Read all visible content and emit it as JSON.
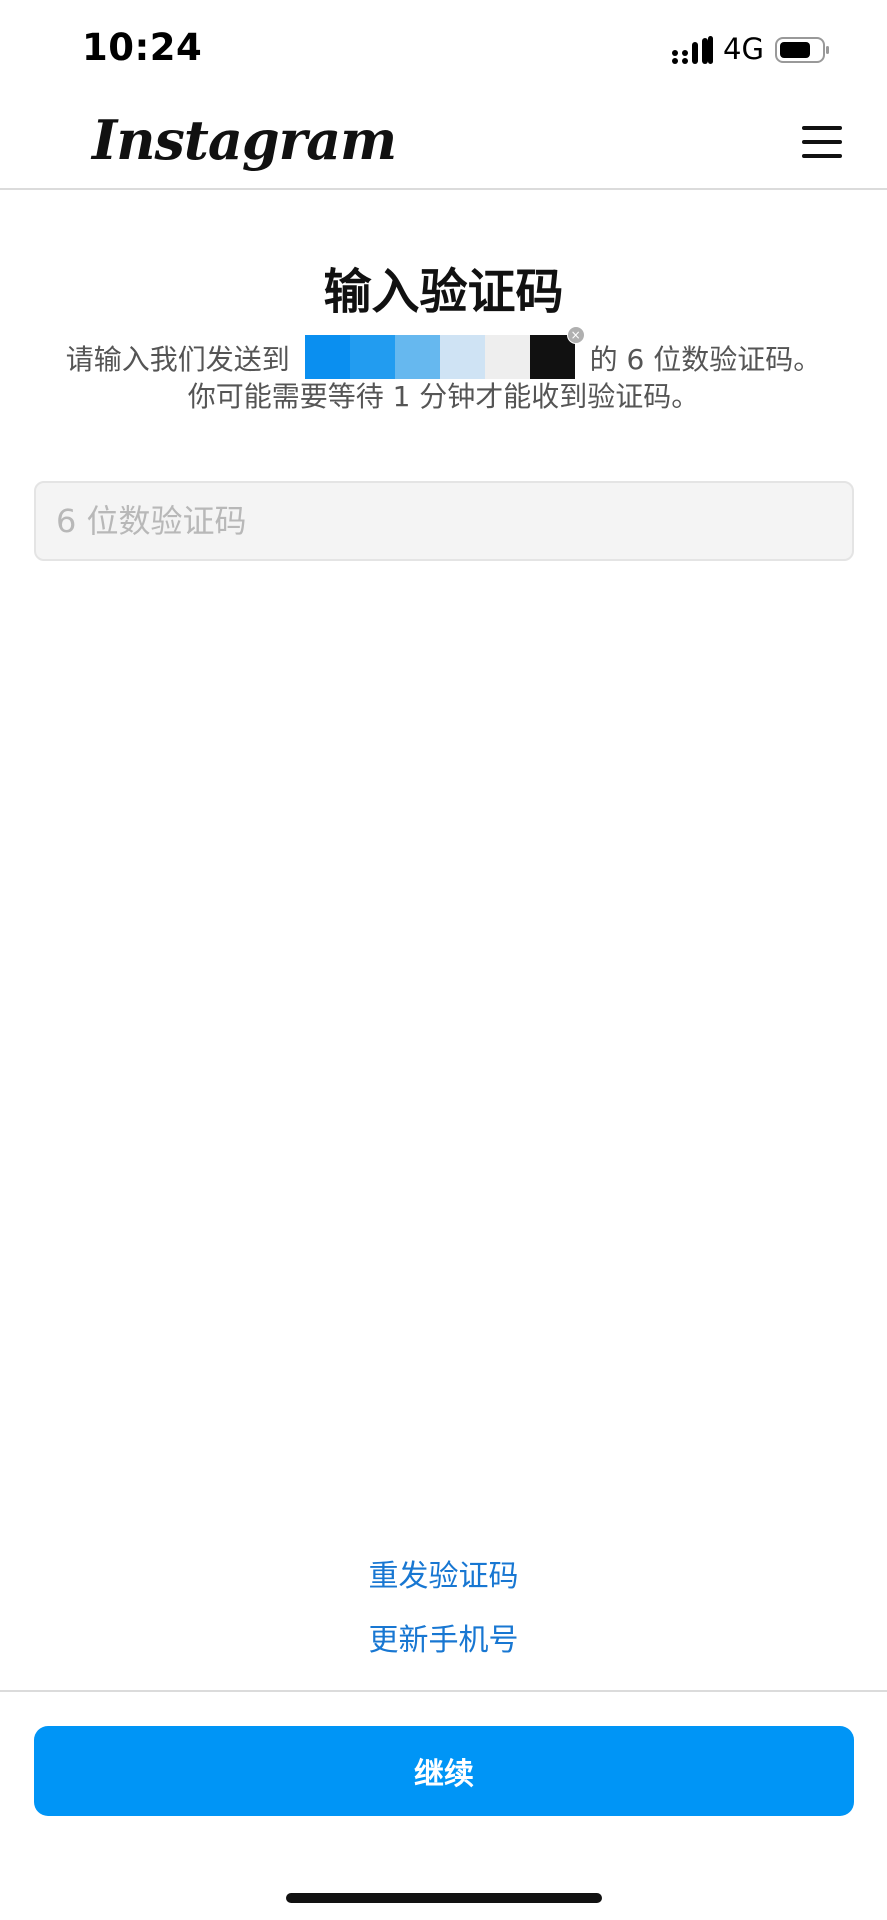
{
  "status_bar": {
    "time": "10:24",
    "network": "4G",
    "signal_icon": "signal-bars-icon",
    "battery_icon": "battery-icon"
  },
  "header": {
    "logo_text": "Instagram",
    "menu_icon": "hamburger-menu-icon"
  },
  "main": {
    "title": "输入验证码",
    "description_prefix": "请输入我们发送到",
    "description_suffix": "的 6 位数验证码。",
    "description_line2": "你可能需要等待 1 分钟才能收到验证码。",
    "redacted_colors": [
      "#0a8ff0",
      "#229cf0",
      "#66b8ef",
      "#cfe3f4",
      "#eeeeee",
      "#111111"
    ],
    "code_input": {
      "placeholder": "6 位数验证码",
      "value": ""
    }
  },
  "actions": {
    "resend_label": "重发验证码",
    "change_phone_label": "更新手机号",
    "continue_label": "继续"
  },
  "colors": {
    "accent": "#0095f6",
    "link": "#1877d2",
    "text_primary": "#111111",
    "text_secondary": "#555555"
  }
}
